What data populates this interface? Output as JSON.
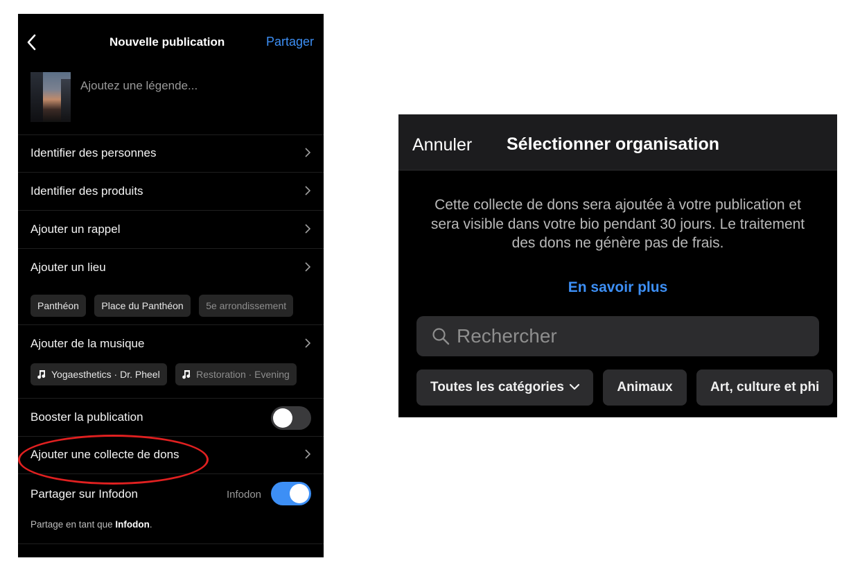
{
  "left": {
    "header": {
      "title": "Nouvelle publication",
      "share_label": "Partager"
    },
    "caption": {
      "placeholder": "Ajoutez une légende..."
    },
    "rows": {
      "tag_people": "Identifier des personnes",
      "tag_products": "Identifier des produits",
      "add_reminder": "Ajouter un rappel",
      "add_location": "Ajouter un lieu",
      "add_music": "Ajouter de la musique",
      "boost": "Booster la publication",
      "fundraiser": "Ajouter une collecte de dons",
      "share_on": "Partager sur Infodon"
    },
    "location_chips": [
      "Panthéon",
      "Place du Panthéon",
      "5e arrondissement"
    ],
    "music_chips": [
      "Yogaesthetics · Dr. Pheel",
      "Restoration · Evening"
    ],
    "share_account": "Infodon",
    "share_note_prefix": "Partage en tant que ",
    "share_note_name": "Infodon",
    "share_note_suffix": ".",
    "toggles": {
      "boost_on": false,
      "share_on": true
    },
    "colors": {
      "accent": "#3d8ff5",
      "highlight": "#e02020"
    }
  },
  "right": {
    "header": {
      "cancel_label": "Annuler",
      "title": "Sélectionner organisation"
    },
    "description": "Cette collecte de dons sera ajoutée à votre publication et sera visible dans votre bio pendant 30 jours. Le traitement des dons ne génère pas de frais.",
    "learn_more": "En savoir plus",
    "search": {
      "placeholder": "Rechercher"
    },
    "categories": [
      "Toutes les catégories",
      "Animaux",
      "Art, culture et phi"
    ]
  }
}
